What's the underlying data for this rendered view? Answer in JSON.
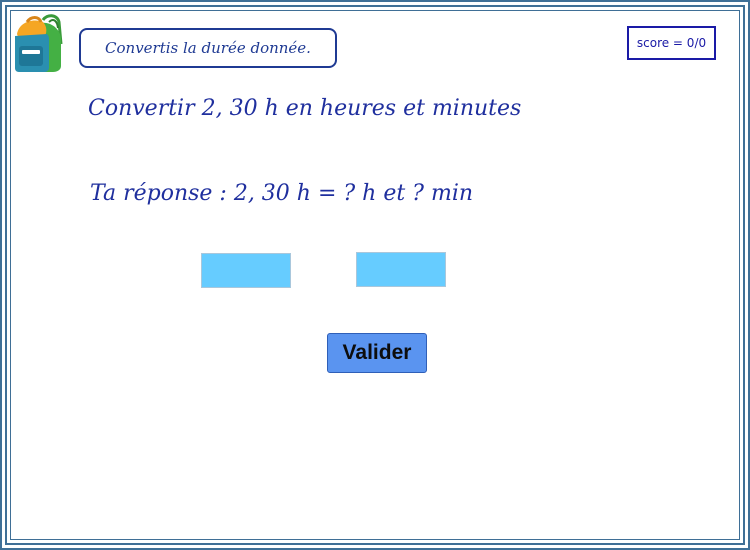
{
  "header": {
    "instruction": "Convertis la durée donnée.",
    "score": "score = 0/0"
  },
  "exercise": {
    "question": "Convertir 2, 30 h en heures et minutes",
    "answer_prompt": "Ta réponse : 2, 30 h  = ? h et ? min",
    "hours_value": "",
    "minutes_value": ""
  },
  "actions": {
    "validate_label": "Valider"
  },
  "icons": {
    "logo": "backpack-icon"
  },
  "colors": {
    "accent_text": "#1f2f9e",
    "input_fill": "#66ccff",
    "button_fill": "#5a94f0",
    "frame": "#3f6f96"
  }
}
